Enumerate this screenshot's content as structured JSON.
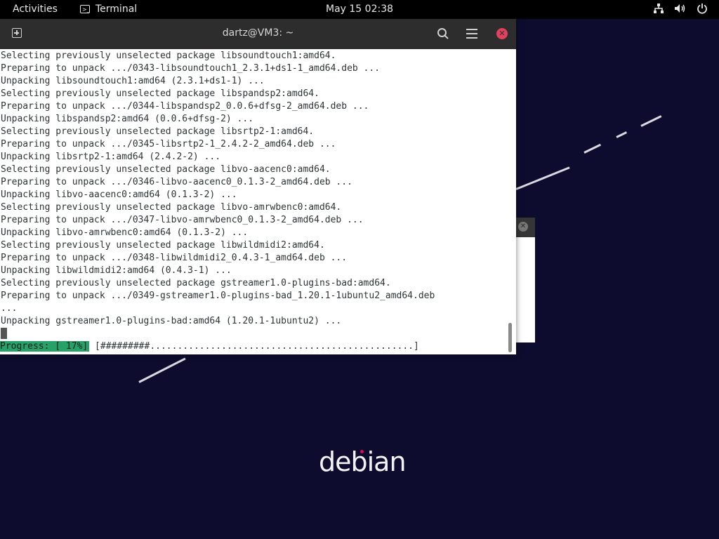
{
  "topbar": {
    "activities": "Activities",
    "app_name": "Terminal",
    "clock": "May 15  02:38",
    "tray_icons": [
      "network-icon",
      "volume-icon",
      "power-icon"
    ]
  },
  "terminal": {
    "title": "dartz@VM3: ~",
    "lines": [
      "Selecting previously unselected package libsoundtouch1:amd64.",
      "Preparing to unpack .../0343-libsoundtouch1_2.3.1+ds1-1_amd64.deb ...",
      "Unpacking libsoundtouch1:amd64 (2.3.1+ds1-1) ...",
      "Selecting previously unselected package libspandsp2:amd64.",
      "Preparing to unpack .../0344-libspandsp2_0.0.6+dfsg-2_amd64.deb ...",
      "Unpacking libspandsp2:amd64 (0.0.6+dfsg-2) ...",
      "Selecting previously unselected package libsrtp2-1:amd64.",
      "Preparing to unpack .../0345-libsrtp2-1_2.4.2-2_amd64.deb ...",
      "Unpacking libsrtp2-1:amd64 (2.4.2-2) ...",
      "Selecting previously unselected package libvo-aacenc0:amd64.",
      "Preparing to unpack .../0346-libvo-aacenc0_0.1.3-2_amd64.deb ...",
      "Unpacking libvo-aacenc0:amd64 (0.1.3-2) ...",
      "Selecting previously unselected package libvo-amrwbenc0:amd64.",
      "Preparing to unpack .../0347-libvo-amrwbenc0_0.1.3-2_amd64.deb ...",
      "Unpacking libvo-amrwbenc0:amd64 (0.1.3-2) ...",
      "Selecting previously unselected package libwildmidi2:amd64.",
      "Preparing to unpack .../0348-libwildmidi2_0.4.3-1_amd64.deb ...",
      "Unpacking libwildmidi2:amd64 (0.4.3-1) ...",
      "Selecting previously unselected package gstreamer1.0-plugins-bad:amd64.",
      "Preparing to unpack .../0349-gstreamer1.0-plugins-bad_1.20.1-1ubuntu2_amd64.deb",
      "...",
      "Unpacking gstreamer1.0-plugins-bad:amd64 (1.20.1-1ubuntu2) ..."
    ],
    "progress_label": "Progress: [ 17%]",
    "progress_bar": " [#########................................................]",
    "progress_percent": 17
  },
  "desktop": {
    "logo_text": "debian"
  },
  "colors": {
    "desktop_bg": "#0d0c2e",
    "progress_green": "#26a269",
    "close_red": "#e0425e",
    "logo_dot": "#d70a53"
  }
}
